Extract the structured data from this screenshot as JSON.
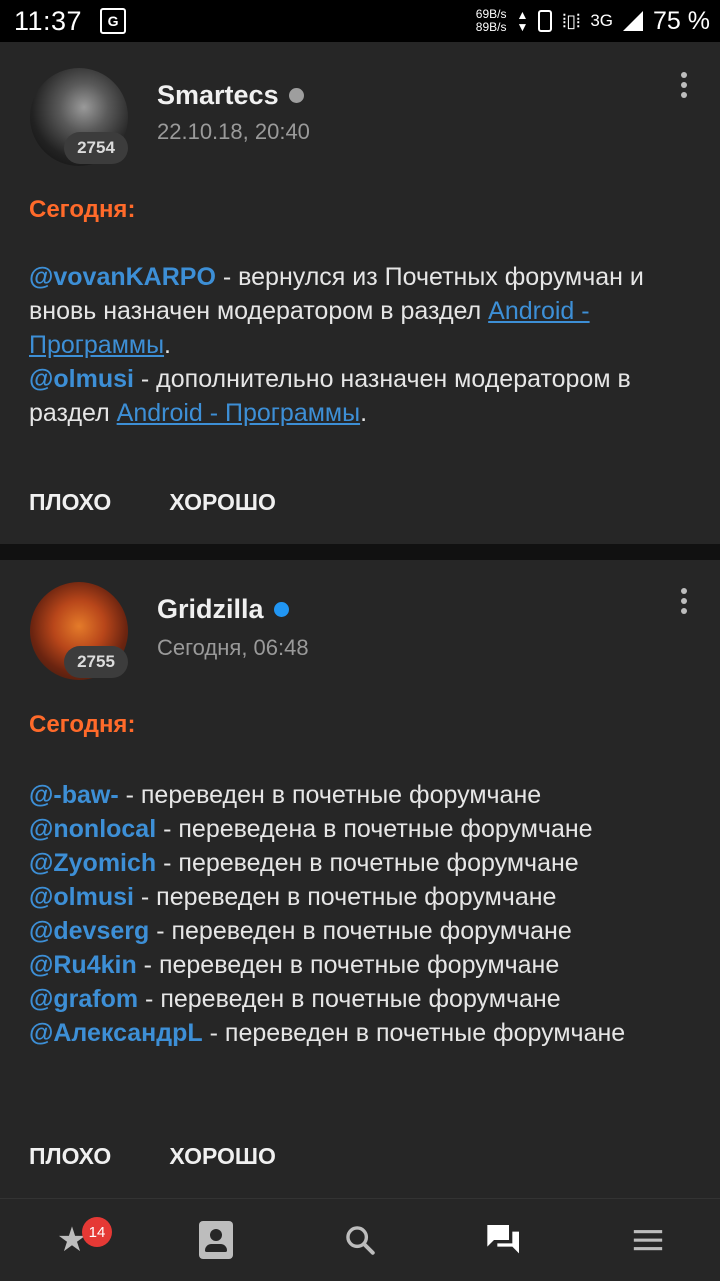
{
  "status_bar": {
    "time": "11:37",
    "translate_icon": "G",
    "speed_up": "69B/s",
    "speed_down": "89B/s",
    "network": "3G",
    "battery": "75 %"
  },
  "posts": [
    {
      "username": "Smartecs",
      "status": "offline",
      "reputation": "2754",
      "date": "22.10.18, 20:40",
      "heading": "Сегодня:",
      "lines": {
        "m1": "@vovanKARPO",
        "t1": " - вернулся из Почетных форумчан и вновь назначен модератором в раздел ",
        "link1": "Android - Программы",
        "t1end": ".",
        "m2": "@olmusi",
        "t2": " - дополнительно назначен модератором в раздел ",
        "link2": "Android - Программы",
        "t2end": "."
      },
      "actions": {
        "bad": "ПЛОХО",
        "good": "ХОРОШО"
      }
    },
    {
      "username": "Gridzilla",
      "status": "online",
      "reputation": "2755",
      "date": "Сегодня, 06:48",
      "heading": "Сегодня:",
      "items": [
        {
          "mention": "@-baw-",
          "text": " - переведен в почетные форумчане"
        },
        {
          "mention": "@nonlocal",
          "text": " - переведена в почетные форумчане"
        },
        {
          "mention": "@Zyomich",
          "text": " - переведен в почетные форумчане"
        },
        {
          "mention": "@olmusi",
          "text": " - переведен в почетные форумчане"
        },
        {
          "mention": "@devserg",
          "text": " - переведен в почетные форумчане"
        },
        {
          "mention": "@Ru4kin",
          "text": " - переведен в почетные форумчане"
        },
        {
          "mention": "@grafom",
          "text": " - переведен в почетные форумчане"
        },
        {
          "mention": "@АлександрL",
          "text": " - переведен в почетные форумчане"
        }
      ],
      "actions": {
        "bad": "ПЛОХО",
        "good": "ХОРОШО"
      }
    }
  ],
  "bottom_nav": {
    "favorites_badge": "14",
    "items": [
      "star-icon",
      "contacts-icon",
      "search-icon",
      "forum-icon",
      "menu-icon"
    ],
    "active": "forum-icon"
  }
}
